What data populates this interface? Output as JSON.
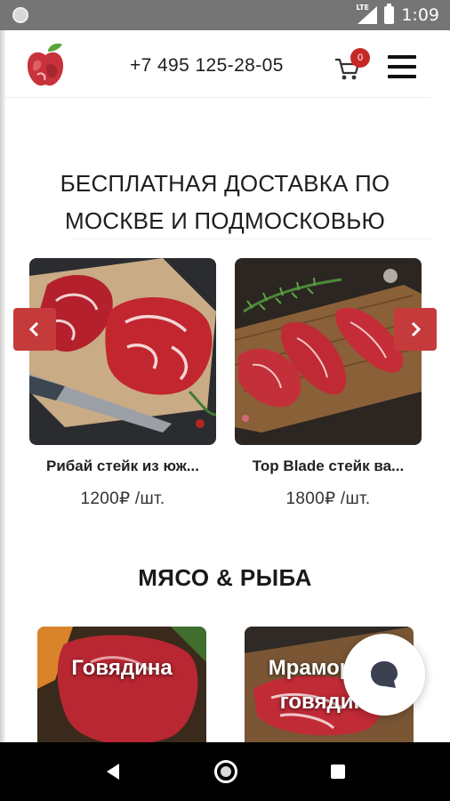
{
  "status_bar": {
    "time": "1:09",
    "network": "LTE"
  },
  "header": {
    "phone": "+7 495 125-28-05",
    "cart_count": "0",
    "icons": [
      "apple-logo-icon",
      "cart-icon",
      "menu-icon"
    ]
  },
  "banner": {
    "title": "БЕСПЛАТНАЯ ДОСТАВКА ПО МОСКВЕ И ПОДМОСКОВЬЮ"
  },
  "products": [
    {
      "name": "Рибай стейк из юж...",
      "price": "1200₽ /шт."
    },
    {
      "name": "Top Blade стейк ва...",
      "price": "1800₽ /шт."
    }
  ],
  "categories_section": {
    "title": "МЯСО & РЫБА",
    "items": [
      {
        "label": "Говядина"
      },
      {
        "label": "Мраморная говядина"
      }
    ]
  },
  "colors": {
    "accent": "#c53b3b",
    "badge": "#c62828",
    "text": "#222222"
  }
}
